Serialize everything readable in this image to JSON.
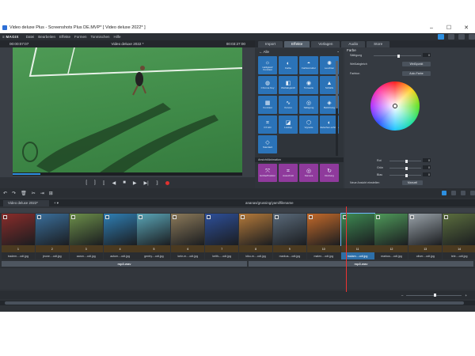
{
  "window": {
    "title": "Video deluxe Plus - Screenshots Plus DE.MVP* [ Video deluxe 2022* ]",
    "controls": [
      "–",
      "☐",
      "✕"
    ]
  },
  "menu": {
    "logo": "≡ MAGIX",
    "items": [
      "Datei",
      "Bearbeiten",
      "Effekte",
      "Formen",
      "Tonmischen",
      "Hilfe"
    ]
  },
  "preview": {
    "left_time": "00:00:07:07",
    "title": "Video deluxe 2022 *",
    "right_time": "00:03:27:00",
    "progress": 0.12
  },
  "transport": [
    "[",
    "]",
    "⟦",
    "◀",
    "■",
    "▶",
    "▶|",
    "⟧"
  ],
  "tabs": [
    "Import",
    "Effekte",
    "Vorlagen",
    "Audio",
    "Store"
  ],
  "active_tab": "Effekte",
  "effects": {
    "back_label": "← Alle",
    "items": [
      {
        "icon": "☼",
        "label": "Helligkeit/ Kontrast"
      },
      {
        "icon": "◐",
        "label": "Farbe"
      },
      {
        "icon": "◓",
        "label": "Farbkorrektur"
      },
      {
        "icon": "✺",
        "label": "Leuchten"
      },
      {
        "icon": "◍",
        "label": "Chroma Key"
      },
      {
        "icon": "◧",
        "label": "Weißabgleich"
      },
      {
        "icon": "◉",
        "label": "Tonwerte"
      },
      {
        "icon": "▲",
        "label": "Schärfe"
      },
      {
        "icon": "▦",
        "label": "Kontrast"
      },
      {
        "icon": "∿",
        "label": "Kurven"
      },
      {
        "icon": "◎",
        "label": "Sättigung"
      },
      {
        "icon": "◈",
        "label": "Belichtung"
      },
      {
        "icon": "⌗",
        "label": "FX HD"
      },
      {
        "icon": "◪",
        "label": "Lookup"
      },
      {
        "icon": "⬡",
        "label": "Vignette"
      },
      {
        "icon": "◐",
        "label": "Zwischen-schritte"
      },
      {
        "icon": "◇",
        "label": "Standard"
      }
    ],
    "section_label": "Ansicht/Animation",
    "bottom_items": [
      {
        "icon": "⤧",
        "label": "Größe/Position"
      },
      {
        "icon": "⌗",
        "label": "Ausschnitt"
      },
      {
        "icon": "◎",
        "label": "Kamera"
      },
      {
        "icon": "↻",
        "label": "Drehung"
      }
    ]
  },
  "color_panel": {
    "title": "Farbe",
    "saturation_label": "Sättigung",
    "saturation_value": "0",
    "wb_label": "Weißabgleich",
    "wb_button": "Weißpunkt",
    "tone_label": "Farbton",
    "auto_button": "Auto-Farbe",
    "sliders": [
      {
        "label": "Rot",
        "value": "0"
      },
      {
        "label": "Grün",
        "value": "0"
      },
      {
        "label": "Blau",
        "value": "0"
      }
    ],
    "reset_label": "Neue Ansicht einstellen",
    "reset_button": "Manuell"
  },
  "timeline": {
    "project_tab": "Video deluxe 2022*",
    "track_label": "ananas/grussing/yaml/filename",
    "zoom_label": "–",
    "clips": [
      {
        "id": "1",
        "name": "tradem....odt.jpg",
        "selected": false
      },
      {
        "id": "2",
        "name": "jeune....odt.jpg",
        "selected": false
      },
      {
        "id": "3",
        "name": "aaron....odt.jpg",
        "selected": false
      },
      {
        "id": "4",
        "name": "autum....odt.jpg",
        "selected": false
      },
      {
        "id": "5",
        "name": "gentry....odt.jpg",
        "selected": false
      },
      {
        "id": "6",
        "name": "kele-m....odt.jpg",
        "selected": false
      },
      {
        "id": "7",
        "name": "kelth-....odt.jpg",
        "selected": false
      },
      {
        "id": "8",
        "name": "kiko-m....odt.jpg",
        "selected": false
      },
      {
        "id": "9",
        "name": "markus....odt.jpg",
        "selected": false
      },
      {
        "id": "10",
        "name": "malen....odt.jpg",
        "selected": false
      },
      {
        "id": "11",
        "name": "malam....odt.jpg",
        "selected": true
      },
      {
        "id": "12",
        "name": "markus....odt.jpg",
        "selected": false
      },
      {
        "id": "13",
        "name": "oliver....odt.jpg",
        "selected": false
      },
      {
        "id": "14",
        "name": "tele....odt.jpg",
        "selected": false
      }
    ],
    "audio_tracks": [
      "mp3.wav",
      "mp3.wav"
    ]
  }
}
